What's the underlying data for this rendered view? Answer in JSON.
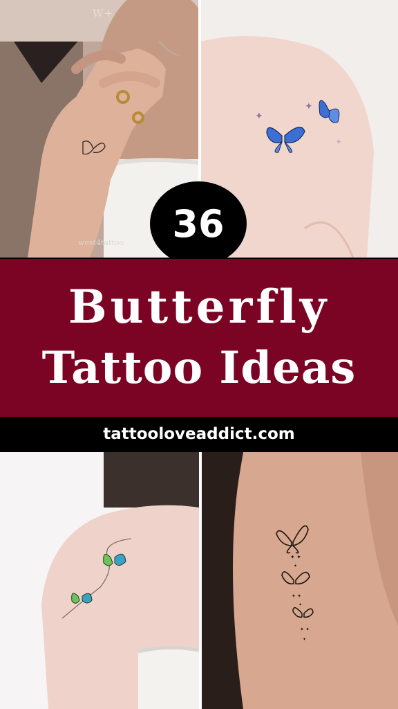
{
  "badge": {
    "number": "36"
  },
  "banner": {
    "line1": "Butterfly",
    "line2": "Tattoo Ideas"
  },
  "footer": {
    "url": "tattooloveaddict.com"
  },
  "watermarks": {
    "logo": "W+",
    "handle": "west4tattoo"
  },
  "photos": [
    {
      "name": "hand-fineline-butterfly-photo"
    },
    {
      "name": "shoulder-blue-butterflies-photo"
    },
    {
      "name": "shoulder-green-butterflies-photo"
    },
    {
      "name": "arm-outline-butterflies-photo"
    }
  ],
  "colors": {
    "banner": "#7b0323",
    "bar": "#000000",
    "text": "#ffffff",
    "blue_butterfly": "#3c6fd6",
    "green_butterfly": "#6fc25a"
  }
}
